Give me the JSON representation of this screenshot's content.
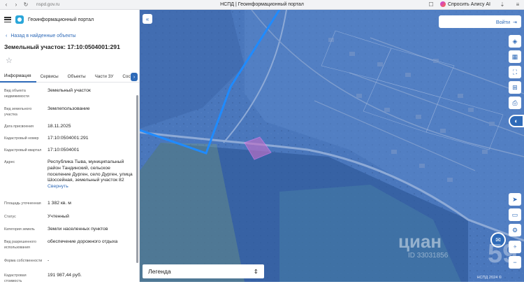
{
  "browser": {
    "url": "nspd.gov.ru",
    "title": "НСПД | Геоинформационный портал",
    "alice_label": "Спросить Алису AI"
  },
  "header": {
    "title": "Геоинформационный портал"
  },
  "back_link": "Назад в найденные объекты",
  "object_title": "Земельный участок: 17:10:0504001:291",
  "tabs": [
    {
      "label": "Информация",
      "active": true
    },
    {
      "label": "Сервисы"
    },
    {
      "label": "Объекты"
    },
    {
      "label": "Части ЗУ"
    },
    {
      "label": "Соста"
    }
  ],
  "properties": [
    {
      "key": "Вид объекта недвижимости",
      "value": "Земельный участок"
    },
    {
      "key": "Вид земельного участка",
      "value": "Землепользование"
    },
    {
      "key": "Дата присвоения",
      "value": "18.11.2025"
    },
    {
      "key": "Кадастровый номер",
      "value": "17:10:0504001:291"
    },
    {
      "key": "Кадастровый квартал",
      "value": "17:10:0504001"
    },
    {
      "key": "Адрес",
      "value": "Республика Тыва, муниципальный район Тандинский, сельское поселение Дурген, село Дурген, улица Шоссейная, земельный участок 82",
      "link": "Свернуть"
    },
    {
      "key": "Площадь уточненная",
      "value": "1 382 кв. м"
    },
    {
      "key": "Статус",
      "value": "Учтенный"
    },
    {
      "key": "Категория земель",
      "value": "Земли населенных пунктов"
    },
    {
      "key": "Вид разрешенного использования",
      "value": "обеспечение дорожного отдыха"
    },
    {
      "key": "Форма собственности",
      "value": "-"
    },
    {
      "key": "Кадастровая стоимость",
      "value": "191 987,44 руб."
    }
  ],
  "map": {
    "login_label": "Войти",
    "legend_label": "Легенда",
    "scale_text": "НСПД 2024 ©",
    "watermark": "циан",
    "watermark_id": "ID 33031856",
    "watermark_num": "59",
    "colors": {
      "overlay": "#4672b6",
      "boundary": "#1f8bff",
      "parcel": "#c070c8"
    }
  }
}
